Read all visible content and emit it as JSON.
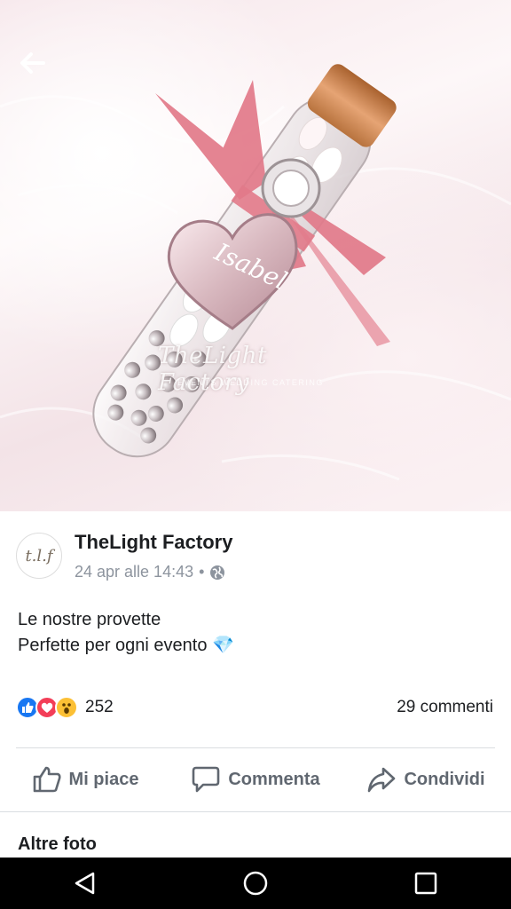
{
  "photo": {
    "watermark": "TheLight Factory",
    "watermark_sub": "EVENTS  WEDDING  CATERING"
  },
  "post": {
    "page_name": "TheLight Factory",
    "timestamp": "24 apr alle 14:43",
    "separator": "•",
    "text_line1": "Le nostre provette",
    "text_line2": "Perfette per ogni evento",
    "emoji": "💎",
    "avatar_initials": "t.l.f"
  },
  "engagement": {
    "reaction_count": "252",
    "comments": "29 commenti"
  },
  "actions": {
    "like": "Mi piace",
    "comment": "Commenta",
    "share": "Condividi"
  },
  "section": {
    "more_photos": "Altre foto"
  },
  "colors": {
    "like_blue": "#1877f2",
    "love_red": "#f33e58",
    "wow_yellow": "#fcc035",
    "ribbon_pink": "#e27a8a"
  },
  "icons": [
    "back-arrow-icon",
    "globe-icon",
    "like-reaction-icon",
    "love-reaction-icon",
    "wow-reaction-icon",
    "thumbs-up-icon",
    "comment-bubble-icon",
    "share-arrow-icon",
    "nav-back-icon",
    "nav-home-icon",
    "nav-recents-icon"
  ]
}
